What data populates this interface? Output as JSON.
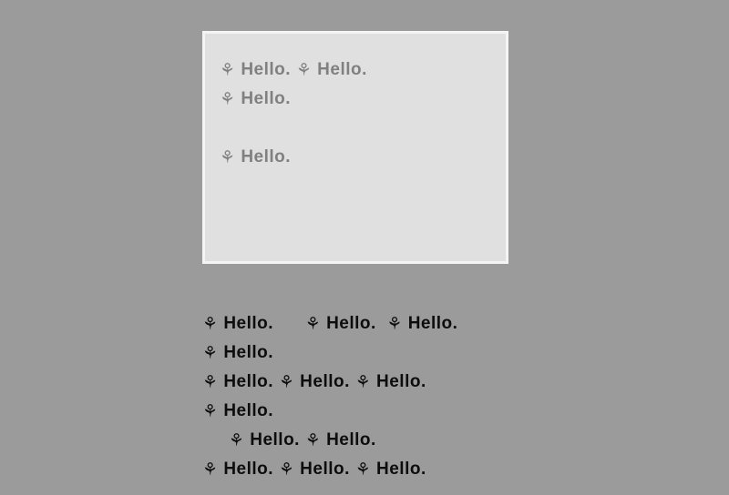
{
  "word": "Hello.",
  "icon_glyph": "⚘",
  "panel": {
    "groups": [
      {
        "items": [
          {
            "gap_before": 0
          },
          {
            "gap_before": 1
          },
          {
            "gap_before": 6
          }
        ]
      },
      {
        "spacer_before": true,
        "items": [
          {
            "gap_before": 0
          }
        ]
      }
    ]
  },
  "lower": {
    "groups": [
      {
        "items": [
          {
            "gap_before": 0
          },
          {
            "gap_before": 6
          },
          {
            "gap_before": 2
          },
          {
            "gap_before": 2
          }
        ]
      },
      {
        "items": [
          {
            "gap_before": 0
          },
          {
            "gap_before": 1
          },
          {
            "gap_before": 1
          },
          {
            "gap_before": 1
          }
        ]
      },
      {
        "items": [
          {
            "gap_before": 5
          },
          {
            "gap_before": 1
          },
          {
            "gap_before": 5
          },
          {
            "gap_before": 1
          },
          {
            "gap_before": 1
          }
        ]
      }
    ]
  }
}
